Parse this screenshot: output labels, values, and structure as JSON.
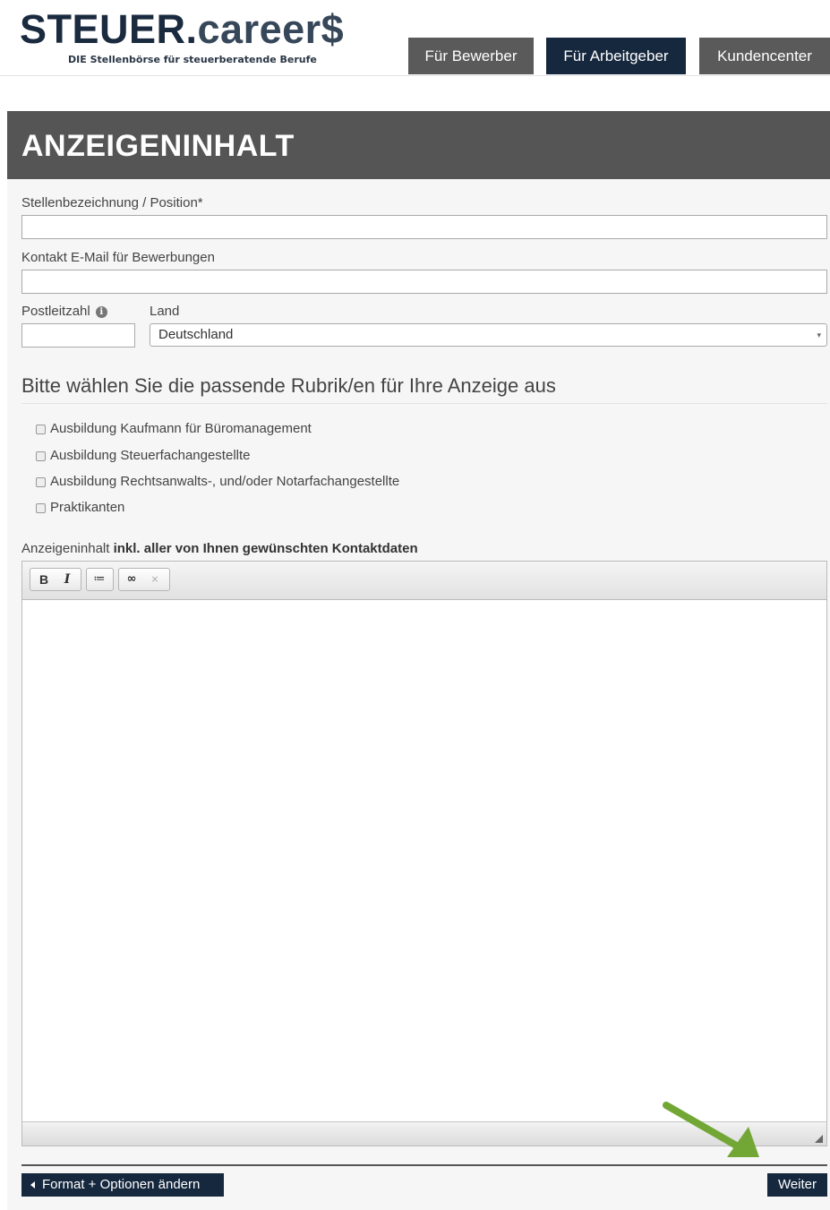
{
  "header": {
    "logo_main": "STEUER.",
    "logo_accent": "career$",
    "logo_tagline": "DIE Stellenbörse für steuerberatende Berufe",
    "nav": {
      "bewerber": "Für Bewerber",
      "arbeitgeber": "Für Arbeitgeber",
      "kundencenter": "Kundencenter"
    }
  },
  "form": {
    "title": "ANZEIGENINHALT",
    "position_label": "Stellenbezeichnung / Position*",
    "position_value": "",
    "email_label": "Kontakt E-Mail für Bewerbungen",
    "email_value": "",
    "plz_label": "Postleitzahl",
    "plz_value": "",
    "land_label": "Land",
    "land_value": "Deutschland",
    "rubrik_heading": "Bitte wählen Sie die passende Rubrik/en für Ihre Anzeige aus",
    "rubriken": [
      {
        "label": "Ausbildung Kaufmann für Büromanagement",
        "checked": false
      },
      {
        "label": "Ausbildung Steuerfachangestellte",
        "checked": false
      },
      {
        "label": "Ausbildung Rechtsanwalts-, und/oder Notarfachangestellte",
        "checked": false
      },
      {
        "label": "Praktikanten",
        "checked": false
      }
    ],
    "content_label": "Anzeigeninhalt",
    "content_label_bold": "inkl. aller von Ihnen gewünschten Kontaktdaten",
    "toolbar": {
      "bold": "B",
      "italic": "I",
      "list": "≔",
      "link": "∞",
      "unlink": "⨯"
    }
  },
  "footer": {
    "back_label": "Format + Optionen ändern",
    "next_label": "Weiter"
  },
  "colors": {
    "navy": "#16283e",
    "grey_nav": "#5a5a5a",
    "panel_head": "#555555",
    "arrow_green": "#72a736"
  }
}
